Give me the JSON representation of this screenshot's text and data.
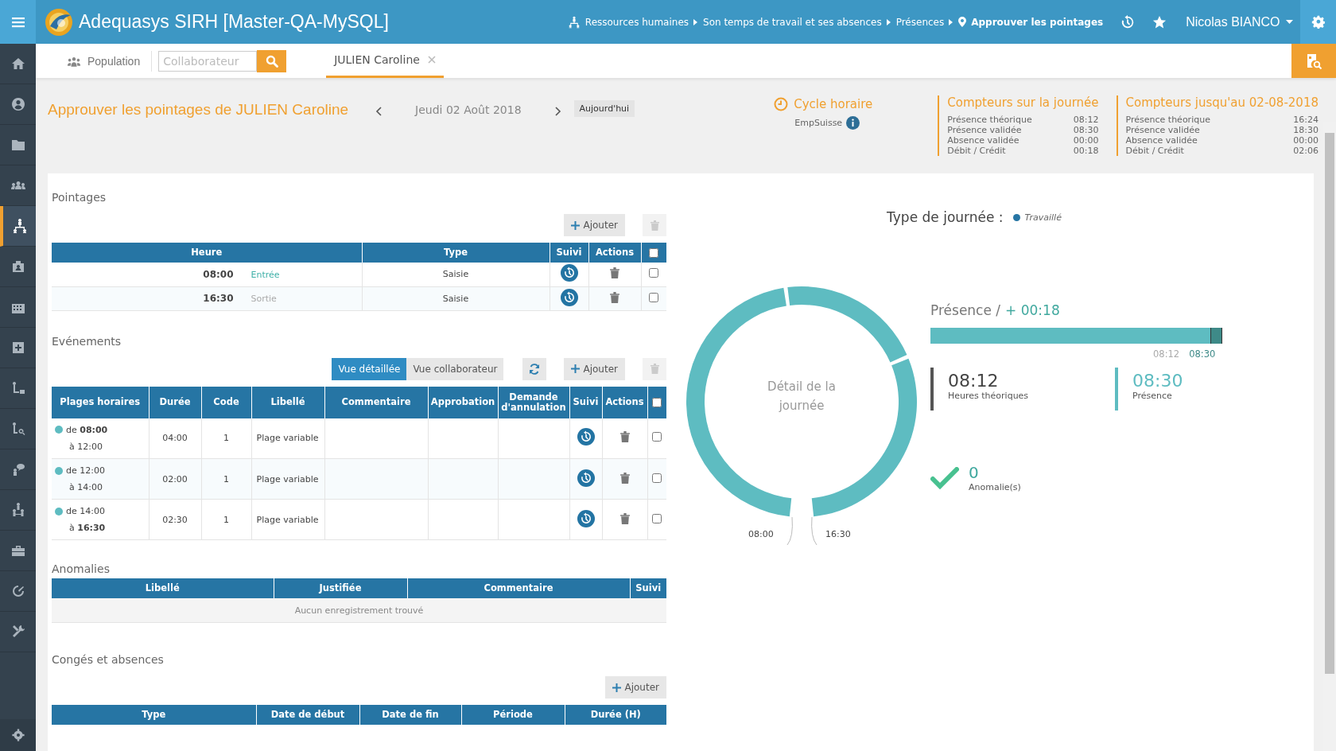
{
  "app": {
    "title": "Adequasys SIRH [Master-QA-MySQL]"
  },
  "breadcrumb": [
    {
      "label": "Ressources humaines",
      "current": false
    },
    {
      "label": "Son temps de travail et ses absences",
      "current": false
    },
    {
      "label": "Présences",
      "current": false
    },
    {
      "label": "Approuver les pointages",
      "current": true
    }
  ],
  "user": {
    "name": "Nicolas BIANCO"
  },
  "sidebar": {
    "items": [
      {
        "kind": "home",
        "selected": false
      },
      {
        "kind": "user",
        "selected": false
      },
      {
        "kind": "folder",
        "selected": false
      },
      {
        "kind": "group",
        "selected": false
      },
      {
        "kind": "org",
        "selected": true
      },
      {
        "kind": "badge",
        "selected": false
      },
      {
        "kind": "building",
        "selected": false
      },
      {
        "kind": "medical",
        "selected": false
      },
      {
        "kind": "branch",
        "selected": false
      },
      {
        "kind": "search",
        "selected": false
      },
      {
        "kind": "chat",
        "selected": false
      },
      {
        "kind": "tree",
        "selected": false
      },
      {
        "kind": "briefcase",
        "selected": false
      },
      {
        "kind": "gauge",
        "selected": false
      },
      {
        "kind": "tools",
        "selected": false
      }
    ]
  },
  "subbar": {
    "population": "Population",
    "search_placeholder": "Collaborateur",
    "tabs": [
      {
        "label": "JULIEN Caroline",
        "selected": true
      }
    ]
  },
  "header": {
    "title": "Approuver les pointages de JULIEN Caroline",
    "date": "Jeudi 02 Août 2018",
    "today": "Aujourd'hui",
    "cycle": {
      "title": "Cycle horaire",
      "name": "EmpSuisse"
    },
    "counters": [
      {
        "title": "Compteurs sur la journée",
        "rows": [
          {
            "label": "Présence théorique",
            "value": "08:12"
          },
          {
            "label": "Présence validée",
            "value": "08:30"
          },
          {
            "label": "Absence validée",
            "value": "00:00"
          },
          {
            "label": "Débit / Crédit",
            "value": "00:18"
          }
        ]
      },
      {
        "title": "Compteurs jusqu'au 02-08-2018",
        "rows": [
          {
            "label": "Présence théorique",
            "value": "16:24"
          },
          {
            "label": "Présence validée",
            "value": "18:30"
          },
          {
            "label": "Absence validée",
            "value": "00:00"
          },
          {
            "label": "Débit / Crédit",
            "value": "02:06"
          }
        ]
      }
    ]
  },
  "pointages": {
    "title": "Pointages",
    "add": "Ajouter",
    "delete_disabled": true,
    "select_all_checked": false,
    "columns": [
      "Heure",
      "Type",
      "Suivi",
      "Actions"
    ],
    "rows": [
      {
        "time": "08:00",
        "direction": "Entrée",
        "kind": "in",
        "type": "Saisie",
        "checked": false
      },
      {
        "time": "16:30",
        "direction": "Sortie",
        "kind": "out",
        "type": "Saisie",
        "checked": false
      }
    ]
  },
  "events": {
    "title": "Evénements",
    "views": [
      {
        "label": "Vue détaillée",
        "selected": true
      },
      {
        "label": "Vue collaborateur",
        "selected": false
      }
    ],
    "add": "Ajouter",
    "delete_disabled": true,
    "select_all_checked": false,
    "columns": [
      "Plages horaires",
      "Durée",
      "Code",
      "Libellé",
      "Commentaire",
      "Approbation",
      "Demande d'annulation",
      "Suivi",
      "Actions"
    ],
    "rows": [
      {
        "from": "de **08:00**",
        "to": "à 12:00",
        "duration": "04:00",
        "code": "1",
        "label": "Plage variable",
        "checked": false
      },
      {
        "from": "de 12:00",
        "to": "à 14:00",
        "duration": "02:00",
        "code": "1",
        "label": "Plage variable",
        "checked": false
      },
      {
        "from": "de 14:00",
        "to": "à **16:30**",
        "duration": "02:30",
        "code": "1",
        "label": "Plage variable",
        "checked": false
      }
    ]
  },
  "anomalies": {
    "title": "Anomalies",
    "columns": [
      "Libellé",
      "Justifiée",
      "Commentaire",
      "Suivi"
    ],
    "empty": "Aucun enregistrement trouvé"
  },
  "leaves": {
    "title": "Congés et absences",
    "add": "Ajouter",
    "columns": [
      "Type",
      "Date de début",
      "Date de fin",
      "Période",
      "Durée (H)"
    ]
  },
  "day": {
    "type_label": "Type de journée :",
    "type_value": "Travaillé",
    "center": "Détail de la journée",
    "start": "08:00",
    "end": "16:30",
    "presence": {
      "label": "Présence /",
      "delta": "+ 00:18",
      "level": 0.965,
      "theoretical": "08:12",
      "actual": "08:30"
    },
    "stats": [
      {
        "value": "08:12",
        "label": "Heures théoriques",
        "kind": "theoretical"
      },
      {
        "value": "08:30",
        "label": "Présence",
        "kind": "actual"
      }
    ],
    "anomalies": {
      "count": "0",
      "label": "Anomalie(s)"
    }
  }
}
